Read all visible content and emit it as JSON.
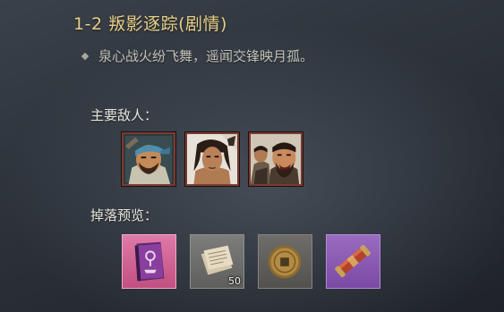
{
  "stage": {
    "title": "1-2  叛影逐踪(剧情)",
    "description": "泉心战火纷飞舞，遥闻交锋映月孤。"
  },
  "enemies": {
    "label": "主要敌人：",
    "items": [
      {
        "icon": "bandana-bandit-portrait"
      },
      {
        "icon": "long-haired-warrior-portrait"
      },
      {
        "icon": "shouting-brute-portrait"
      }
    ]
  },
  "drops": {
    "label": "掉落预览：",
    "items": [
      {
        "icon": "pink-manual-book-icon",
        "quality_color": "#d0608f",
        "count": ""
      },
      {
        "icon": "paper-scroll-icon",
        "quality_color": "#6f6f6d",
        "count": "50"
      },
      {
        "icon": "copper-coin-icon",
        "quality_color": "#5f5e5a",
        "count": ""
      },
      {
        "icon": "red-scroll-case-icon",
        "quality_color": "#8a5bb2",
        "count": ""
      }
    ]
  }
}
